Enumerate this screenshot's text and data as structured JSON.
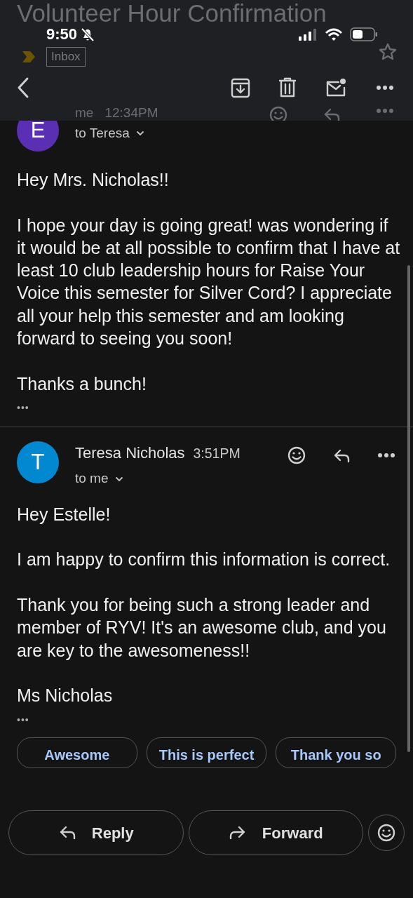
{
  "status_bar": {
    "time": "9:50",
    "silent": true
  },
  "thread": {
    "subject": "Volunteer Hour Confirmation",
    "label": "Inbox"
  },
  "messages": [
    {
      "sender": "me",
      "time": "12:34PM",
      "recipient": "to Teresa",
      "avatar": "E",
      "color": "#5a2fb4",
      "under_header": true,
      "body": [
        "Hey Mrs. Nicholas!!",
        "I hope your day is going great! was wondering if it would be at all possible to confirm that I have at least 10 club leadership hours for Raise Your Voice this semester for Silver Cord? I appreciate all your help this semester and am looking forward to seeing you soon!",
        "Thanks a bunch!"
      ],
      "more": "•••"
    },
    {
      "sender": "Teresa Nicholas",
      "time": "3:51PM",
      "recipient": "to me",
      "avatar": "T",
      "color": "#0288d1",
      "under_header": false,
      "body": [
        "Hey Estelle!",
        "I am happy to confirm this information is correct.",
        "Thank you for being such a strong leader and member of RYV! It's an awesome club, and you are key to the awesomeness!!",
        "Ms Nicholas"
      ],
      "more": "•••"
    }
  ],
  "smart_replies": [
    "Awesome",
    "This is perfect",
    "Thank you so"
  ],
  "actions": [
    {
      "label": "Reply",
      "kind": "reply"
    },
    {
      "label": "Forward",
      "kind": "forward"
    }
  ]
}
